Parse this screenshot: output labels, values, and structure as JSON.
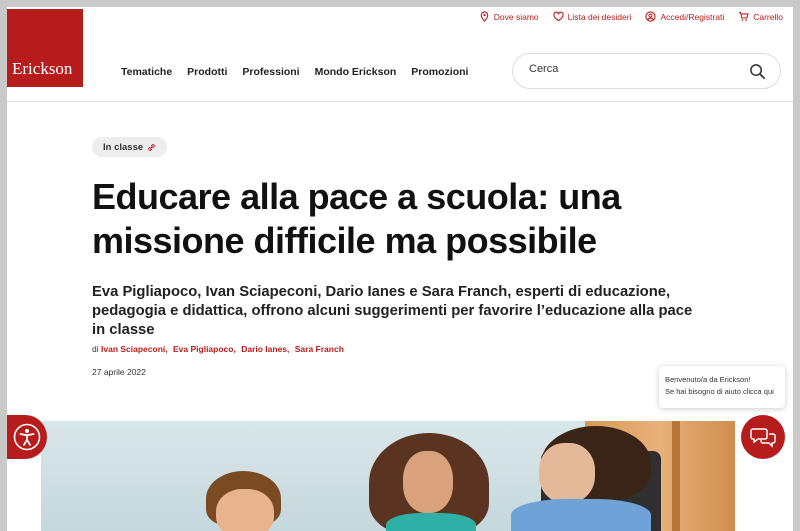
{
  "header": {
    "logo_text": "Erickson",
    "utility": {
      "location": "Dove siamo",
      "wishlist": "Lista dei desideri",
      "account": "Accedi/Registrati",
      "cart": "Carrello"
    },
    "nav": [
      "Tematiche",
      "Prodotti",
      "Professioni",
      "Mondo Erickson",
      "Promozioni"
    ],
    "search_placeholder": "Cerca"
  },
  "article": {
    "category_tag": "In classe",
    "title": "Educare alla pace a scuola: una missione difficile ma possibile",
    "subtitle": "Eva Pigliapoco, Ivan Sciapeconi, Dario Ianes e Sara Franch, esperti di educazione, pedagogia e didattica, offrono alcuni suggerimenti per favorire l’educazione alla pace in classe",
    "by_prefix": "di",
    "authors": [
      "Ivan Sciapeconi,",
      "Eva Pigliapoco,",
      "Dario Ianes,",
      "Sara Franch"
    ],
    "date": "27 aprile 2022"
  },
  "chat": {
    "line1": "Benvenuto/a da Erickson!",
    "line2": "Se hai bisogno di aiuto clicca qui"
  },
  "colors": {
    "brand": "#b71c1c",
    "text": "#111111",
    "tag_bg": "#ededed"
  }
}
